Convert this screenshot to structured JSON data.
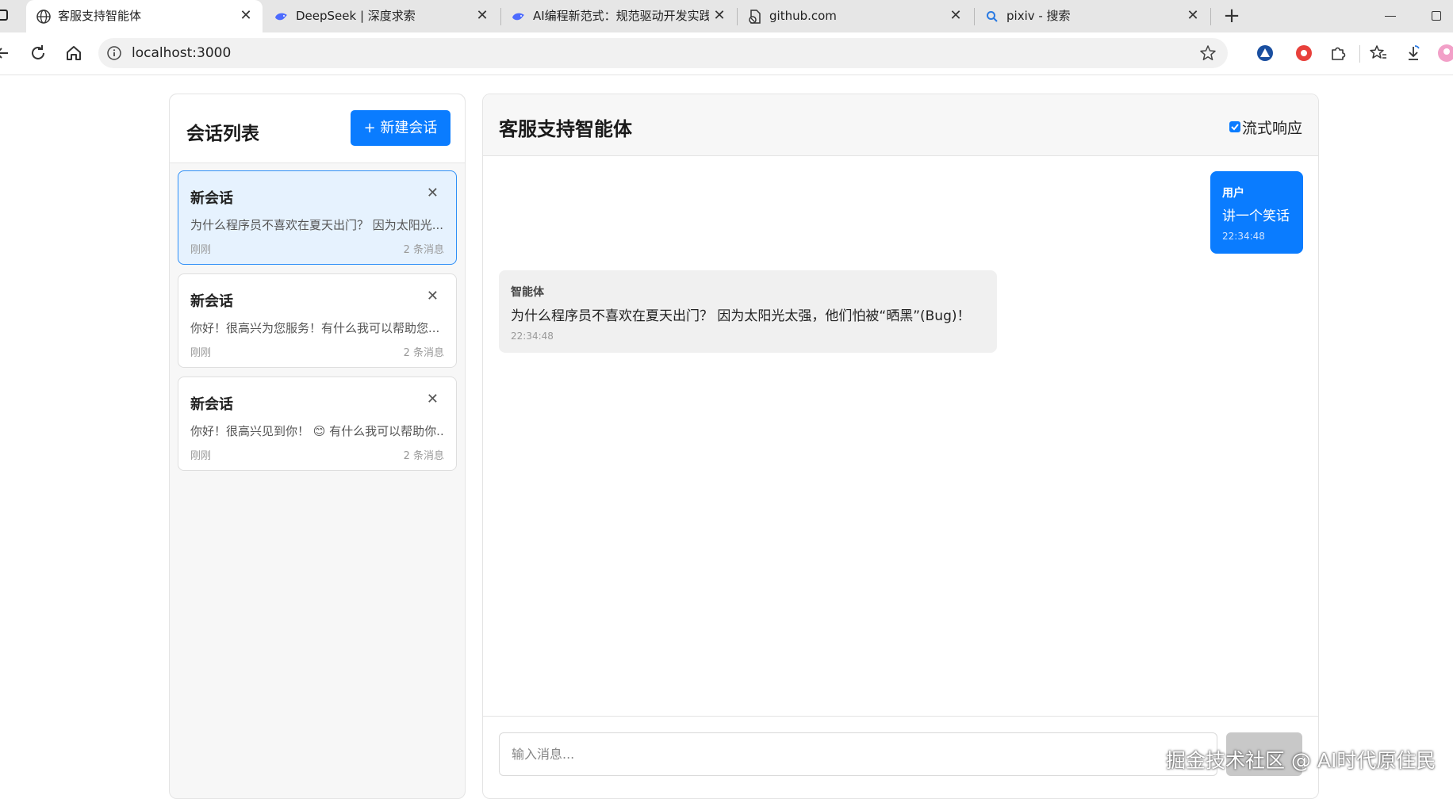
{
  "browser": {
    "tabs": [
      {
        "title": "客服支持智能体",
        "active": true
      },
      {
        "title": "DeepSeek | 深度求索",
        "active": false
      },
      {
        "title": "AI编程新范式：规范驱动开发实践",
        "active": false
      },
      {
        "title": "github.com",
        "active": false
      },
      {
        "title": "pixiv - 搜索",
        "active": false
      }
    ],
    "close_glyph": "✕",
    "new_tab_glyph": "+",
    "url": "localhost:3000",
    "accent_color": "#0a7cff"
  },
  "sidebar": {
    "title": "会话列表",
    "new_button_label": "+ 新建会话",
    "close_glyph": "✕",
    "sessions": [
      {
        "title": "新会话",
        "preview": "为什么程序员不喜欢在夏天出门？ 因为太阳光...",
        "time": "刚刚",
        "count": "2 条消息",
        "active": true
      },
      {
        "title": "新会话",
        "preview": "你好！很高兴为您服务！有什么我可以帮助您...",
        "time": "刚刚",
        "count": "2 条消息",
        "active": false
      },
      {
        "title": "新会话",
        "preview": "你好！很高兴见到你！ 😊 有什么我可以帮助你...",
        "time": "刚刚",
        "count": "2 条消息",
        "active": false
      }
    ]
  },
  "chat": {
    "title": "客服支持智能体",
    "stream_label": "流式响应",
    "stream_checked": true,
    "messages": [
      {
        "role": "用户",
        "text": "讲一个笑话",
        "time": "22:34:48"
      },
      {
        "role": "智能体",
        "text": "为什么程序员不喜欢在夏天出门？ 因为太阳光太强，他们怕被“晒黑”(Bug)！",
        "time": "22:34:48"
      }
    ],
    "input_placeholder": "输入消息..."
  },
  "watermark": "掘金技术社区 @ AI时代原住民"
}
